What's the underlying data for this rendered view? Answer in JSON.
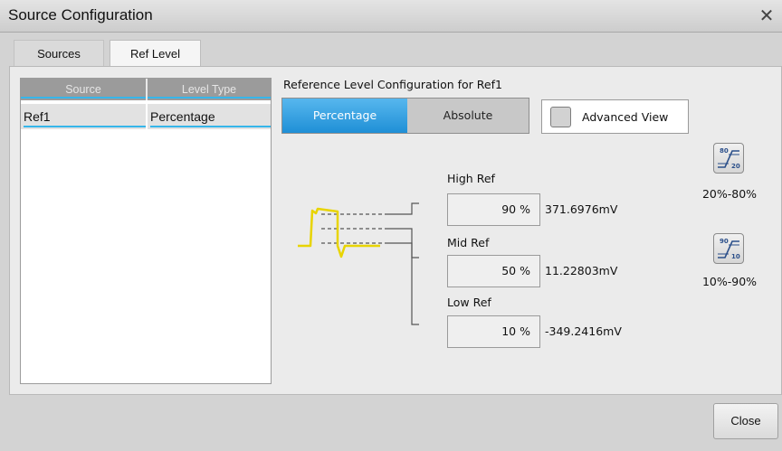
{
  "window": {
    "title": "Source Configuration",
    "close_glyph": "✕"
  },
  "tabs": [
    {
      "label": "Sources",
      "active": false
    },
    {
      "label": "Ref Level",
      "active": true
    }
  ],
  "source_table": {
    "columns": [
      "Source",
      "Level Type"
    ],
    "rows": [
      {
        "source": "Ref1",
        "level_type": "Percentage"
      }
    ]
  },
  "config": {
    "title": "Reference Level Configuration for Ref1",
    "modes": [
      "Percentage",
      "Absolute"
    ],
    "active_mode": "Percentage",
    "advanced_view": {
      "label": "Advanced View",
      "checked": false
    }
  },
  "levels": {
    "high": {
      "label": "High Ref",
      "percent": "90 %",
      "value": "371.6976mV"
    },
    "mid": {
      "label": "Mid Ref",
      "percent": "50 %",
      "value": "11.22803mV"
    },
    "low": {
      "label": "Low Ref",
      "percent": "10 %",
      "value": "-349.2416mV"
    }
  },
  "presets": [
    {
      "label": "20%-80%",
      "top_num": "80",
      "bottom_num": "20"
    },
    {
      "label": "10%-90%",
      "top_num": "90",
      "bottom_num": "10"
    }
  ],
  "footer": {
    "close_label": "Close"
  },
  "colors": {
    "accent": "#36b6ea",
    "waveform": "#e8d400"
  }
}
